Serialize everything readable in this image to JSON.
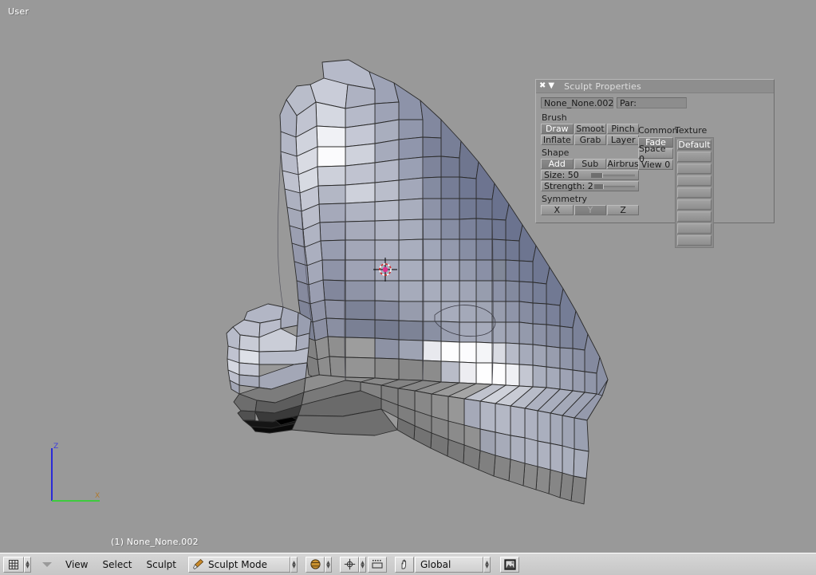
{
  "viewport": {
    "view_label": "User",
    "object_label": "(1) None_None.002",
    "background_color": "#999999",
    "axis_gizmo": {
      "z_label": "Z",
      "x_label": "X",
      "z_color": "#2a2ad8",
      "x_color": "#3ecb3e"
    },
    "cursor_3d": {
      "name": "3d-cursor",
      "color": "#e1318c"
    }
  },
  "panel": {
    "title": "Sculpt Properties",
    "close_icon": "✖",
    "collapse_icon": "▼",
    "name_field": "None_None.002",
    "parent_label": "Par:",
    "parent_value": "",
    "brush": {
      "label": "Brush",
      "buttons": [
        {
          "label": "Draw",
          "active": true
        },
        {
          "label": "Smoot",
          "active": false
        },
        {
          "label": "Pinch",
          "active": false
        },
        {
          "label": "Inflate",
          "active": false
        },
        {
          "label": "Grab",
          "active": false
        },
        {
          "label": "Layer",
          "active": false
        }
      ]
    },
    "shape": {
      "label": "Shape",
      "buttons": [
        {
          "label": "Add",
          "active": true
        },
        {
          "label": "Sub",
          "active": false
        },
        {
          "label": "Airbrus",
          "active": false
        }
      ],
      "sliders": [
        {
          "label": "Size: 50",
          "value": 50,
          "min": 0,
          "max": 200,
          "fill": 0.25
        },
        {
          "label": "Strength: 2",
          "value": 2,
          "min": 0,
          "max": 100,
          "fill": 0.1
        }
      ]
    },
    "symmetry": {
      "label": "Symmetry",
      "buttons": [
        {
          "label": "X",
          "active": false
        },
        {
          "label": "Y",
          "active": false,
          "dim": true
        },
        {
          "label": "Z",
          "active": false
        }
      ]
    },
    "common": {
      "label": "Common",
      "buttons": [
        {
          "label": "Fade",
          "active": true
        },
        {
          "label": "Space 0",
          "active": false
        },
        {
          "label": "View 0",
          "active": false
        }
      ]
    },
    "texture": {
      "label": "Texture",
      "slots": [
        {
          "label": "Default",
          "active": true
        },
        {
          "label": "",
          "active": false
        },
        {
          "label": "",
          "active": false
        },
        {
          "label": "",
          "active": false
        },
        {
          "label": "",
          "active": false
        },
        {
          "label": "",
          "active": false
        },
        {
          "label": "",
          "active": false
        },
        {
          "label": "",
          "active": false
        },
        {
          "label": "",
          "active": false
        }
      ]
    }
  },
  "toolbar": {
    "editor_type_icon": "grid-icon",
    "window_menu_icon": "caret-down-icon",
    "menus": [
      "View",
      "Select",
      "Sculpt"
    ],
    "mode": {
      "icon": "brush-icon",
      "label": "Sculpt Mode"
    },
    "draw_type": {
      "icon": "solid-shading-icon"
    },
    "pivot": {
      "icon": "pivot-icon"
    },
    "snap": {
      "icon": "snap-icon"
    },
    "manipulator": {
      "icon": "hand-icon",
      "label": "Global"
    },
    "render_button": {
      "icon": "render-image-icon"
    }
  }
}
